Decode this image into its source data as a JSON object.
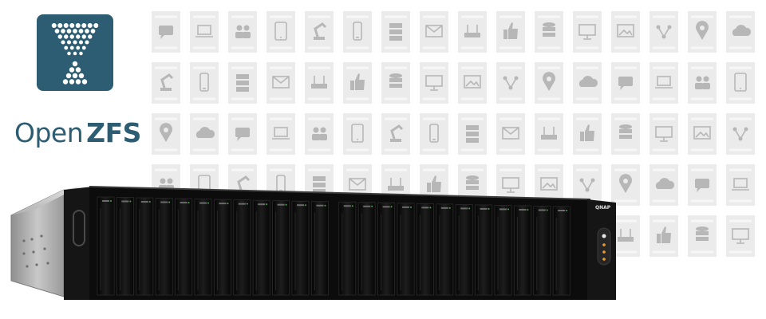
{
  "logo": {
    "brand_prefix": "Open",
    "brand_suffix": "ZFS",
    "icon": "openzfs-z-icon",
    "color": "#2d5d72"
  },
  "background": {
    "tile_color": "#ebebeb",
    "icon_color": "#b7b7b7",
    "icons": [
      "chat-icon",
      "monitor-icon",
      "server-icon",
      "laptop-icon",
      "image-icon",
      "mail-icon",
      "users-icon",
      "network-icon",
      "router-icon",
      "tablet-icon",
      "location-pin-icon",
      "thumbs-up-icon",
      "robot-arm-icon",
      "cloud-icon",
      "database-icon",
      "phone-icon"
    ]
  },
  "device": {
    "brand_label": "QNAP",
    "drive_bays": 24,
    "chassis_color": "#111111",
    "side_color": "#b9b9b9"
  }
}
